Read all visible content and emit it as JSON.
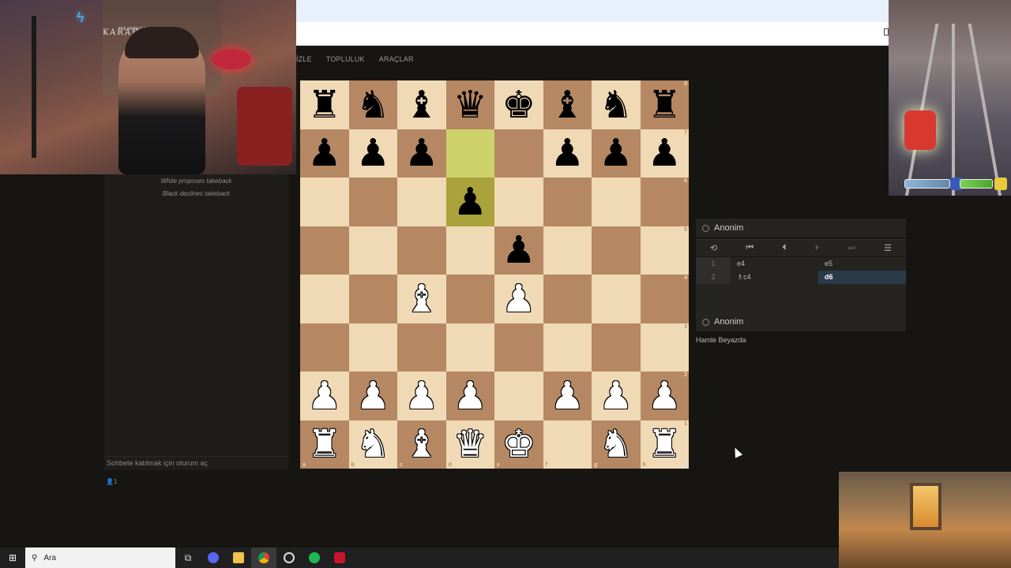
{
  "nav": {
    "items": [
      "İZLE",
      "TOPLULUK",
      "ARAÇLAR"
    ]
  },
  "overlay": {
    "webcam_sign": "KARAHANK7",
    "webcam_sign_sub": "THE WORLD OF"
  },
  "chat": {
    "messages": [
      "White proposes takeback",
      "Black declines takeback"
    ],
    "input_placeholder": "Sohbete katılmak için oturum aç",
    "spectators": "1"
  },
  "board": {
    "ranks": [
      [
        {
          "p": "♜",
          "c": "black"
        },
        {
          "p": "♞",
          "c": "black"
        },
        {
          "p": "♝",
          "c": "black"
        },
        {
          "p": "♛",
          "c": "black"
        },
        {
          "p": "♚",
          "c": "black"
        },
        {
          "p": "♝",
          "c": "black"
        },
        {
          "p": "♞",
          "c": "black"
        },
        {
          "p": "♜",
          "c": "black"
        }
      ],
      [
        {
          "p": "♟",
          "c": "black"
        },
        {
          "p": "♟",
          "c": "black"
        },
        {
          "p": "♟",
          "c": "black"
        },
        {
          "p": "",
          "c": "",
          "hl": true
        },
        {
          "p": "",
          "c": ""
        },
        {
          "p": "♟",
          "c": "black"
        },
        {
          "p": "♟",
          "c": "black"
        },
        {
          "p": "♟",
          "c": "black"
        }
      ],
      [
        {
          "p": "",
          "c": ""
        },
        {
          "p": "",
          "c": ""
        },
        {
          "p": "",
          "c": ""
        },
        {
          "p": "♟",
          "c": "black",
          "hl": true
        },
        {
          "p": "",
          "c": ""
        },
        {
          "p": "",
          "c": ""
        },
        {
          "p": "",
          "c": ""
        },
        {
          "p": "",
          "c": ""
        }
      ],
      [
        {
          "p": "",
          "c": ""
        },
        {
          "p": "",
          "c": ""
        },
        {
          "p": "",
          "c": ""
        },
        {
          "p": "",
          "c": ""
        },
        {
          "p": "♟",
          "c": "black"
        },
        {
          "p": "",
          "c": ""
        },
        {
          "p": "",
          "c": ""
        },
        {
          "p": "",
          "c": ""
        }
      ],
      [
        {
          "p": "",
          "c": ""
        },
        {
          "p": "",
          "c": ""
        },
        {
          "p": "♝",
          "c": "white"
        },
        {
          "p": "",
          "c": ""
        },
        {
          "p": "♟",
          "c": "white"
        },
        {
          "p": "",
          "c": ""
        },
        {
          "p": "",
          "c": ""
        },
        {
          "p": "",
          "c": ""
        }
      ],
      [
        {
          "p": "",
          "c": ""
        },
        {
          "p": "",
          "c": ""
        },
        {
          "p": "",
          "c": ""
        },
        {
          "p": "",
          "c": ""
        },
        {
          "p": "",
          "c": ""
        },
        {
          "p": "",
          "c": ""
        },
        {
          "p": "",
          "c": ""
        },
        {
          "p": "",
          "c": ""
        }
      ],
      [
        {
          "p": "♟",
          "c": "white"
        },
        {
          "p": "♟",
          "c": "white"
        },
        {
          "p": "♟",
          "c": "white"
        },
        {
          "p": "♟",
          "c": "white"
        },
        {
          "p": "",
          "c": ""
        },
        {
          "p": "♟",
          "c": "white"
        },
        {
          "p": "♟",
          "c": "white"
        },
        {
          "p": "♟",
          "c": "white"
        }
      ],
      [
        {
          "p": "♜",
          "c": "white"
        },
        {
          "p": "♞",
          "c": "white"
        },
        {
          "p": "♝",
          "c": "white"
        },
        {
          "p": "♛",
          "c": "white"
        },
        {
          "p": "♚",
          "c": "white"
        },
        {
          "p": "",
          "c": ""
        },
        {
          "p": "♞",
          "c": "white"
        },
        {
          "p": "♜",
          "c": "white"
        }
      ]
    ],
    "rank_labels": [
      "8",
      "7",
      "6",
      "5",
      "4",
      "3",
      "2",
      "1"
    ],
    "file_labels": [
      "a",
      "b",
      "c",
      "d",
      "e",
      "f",
      "g",
      "h"
    ],
    "colors": {
      "light": "#f0d9b5",
      "dark": "#b58863",
      "highlight": "#cdd26a"
    }
  },
  "players": {
    "top": "Anonim",
    "bottom": "Anonim"
  },
  "controls": {
    "icons": [
      "flip-icon",
      "first-icon",
      "prev-icon",
      "next-icon",
      "last-icon",
      "menu-icon"
    ]
  },
  "moves": [
    {
      "n": "1",
      "white": "e4",
      "black": "e5"
    },
    {
      "n": "2",
      "white": "♗c4",
      "black": "d6"
    }
  ],
  "status": "Hamle Beyazda",
  "taskbar": {
    "search_placeholder": "Ara"
  }
}
